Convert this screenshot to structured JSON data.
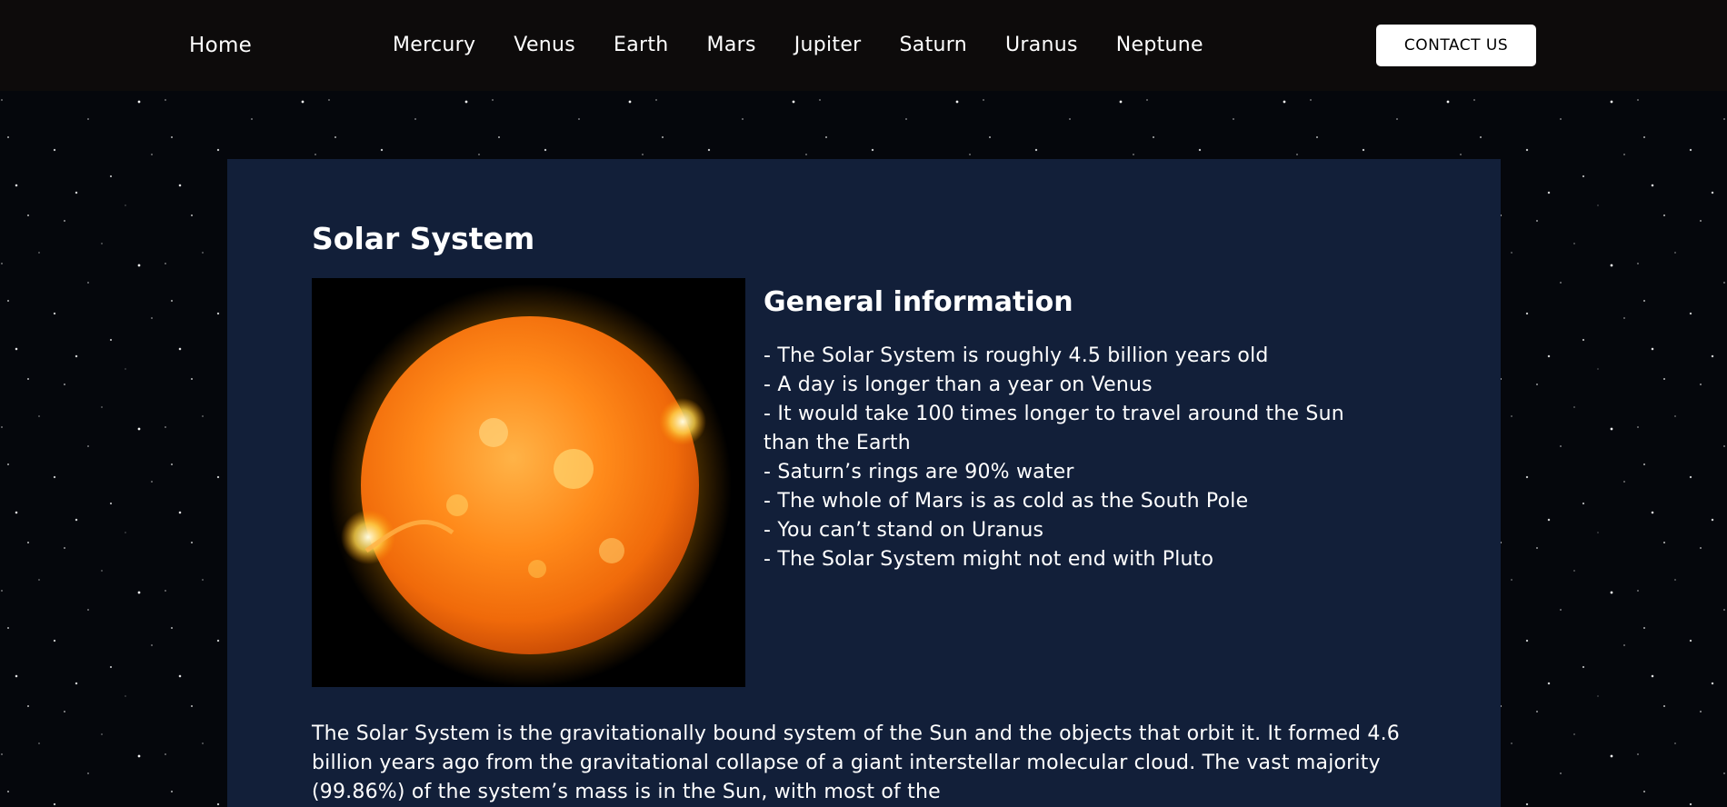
{
  "nav": {
    "home_label": "Home",
    "planets": [
      "Mercury",
      "Venus",
      "Earth",
      "Mars",
      "Jupiter",
      "Saturn",
      "Uranus",
      "Neptune"
    ],
    "contact_label": "CONTACT US"
  },
  "main": {
    "title": "Solar System",
    "image_subject": "sun",
    "info_heading": "General information",
    "facts": [
      "- The Solar System is roughly 4.5 billion years old",
      "- A day is longer than a year on Venus",
      "- It would take 100 times longer to travel around the Sun than the Earth",
      "- Saturn’s rings are 90% water",
      "- The whole of Mars is as cold as the South Pole",
      "- You can’t stand on Uranus",
      "- The Solar System might not end with Pluto"
    ],
    "intro": "The Solar System is the gravitationally bound system of the Sun and the objects that orbit it. It formed 4.6 billion years ago from the gravitational collapse of a giant interstellar molecular cloud. The vast majority (99.86%) of the system’s mass is in the Sun, with most of the"
  },
  "colors": {
    "nav_background": "#0d0b0b",
    "panel_background": "#121f39",
    "text": "#ffffff",
    "button_background": "#ffffff",
    "button_text": "#000000"
  }
}
